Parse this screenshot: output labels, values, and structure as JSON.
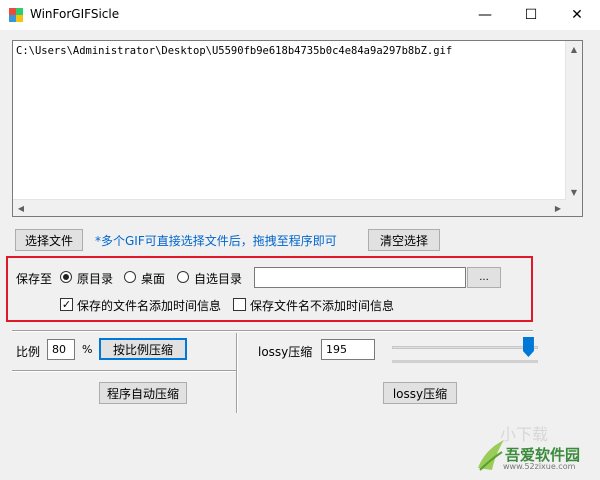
{
  "window": {
    "title": "WinForGIFSicle",
    "minimize_glyph": "—",
    "maximize_glyph": "☐",
    "close_glyph": "✕"
  },
  "file_list": {
    "items": [
      "C:\\Users\\Administrator\\Desktop\\U5590fb9e618b4735b0c4e84a9a297b8bZ.gif"
    ]
  },
  "toolbar": {
    "select_file_label": "选择文件",
    "hint_text": "*多个GIF可直接选择文件后，拖拽至程序即可",
    "clear_selection_label": "清空选择"
  },
  "save_options": {
    "save_to_label": "保存至",
    "radio_original_label": "原目录",
    "radio_desktop_label": "桌面",
    "radio_custom_label": "自选目录",
    "selected_radio": "original",
    "custom_dir_value": "",
    "browse_label": "...",
    "add_time_label": "保存的文件名添加时间信息",
    "add_time_checked": true,
    "no_time_label": "保存文件名不添加时间信息",
    "no_time_checked": false
  },
  "scale": {
    "ratio_label": "比例",
    "ratio_value": "80",
    "percent_label": "%",
    "compress_by_ratio_label": "按比例压缩",
    "auto_compress_label": "程序自动压缩"
  },
  "lossy": {
    "label": "lossy压缩",
    "value": "195",
    "slider_fraction": 0.97,
    "button_label": "lossy压缩"
  },
  "watermark": {
    "name": "吾爱软件园",
    "url": "www.52zixue.com"
  },
  "colors": {
    "accent": "#0078d7",
    "highlight_frame": "#e0192a",
    "hint": "#0066cc"
  }
}
